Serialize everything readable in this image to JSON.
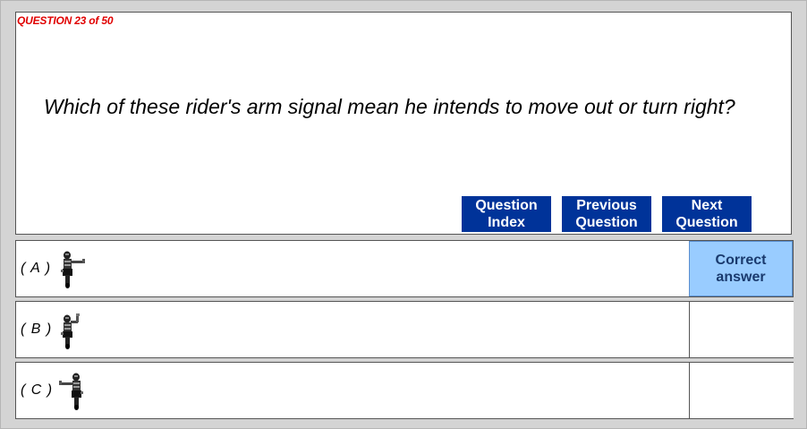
{
  "header": {
    "counter": "QUESTION 23 of 50"
  },
  "question": {
    "text": "Which of these rider's arm signal mean he intends to move out or turn right?"
  },
  "navigation": {
    "index": {
      "line1": "Question",
      "line2": "Index"
    },
    "previous": {
      "line1": "Previous",
      "line2": "Question"
    },
    "next": {
      "line1": "Next",
      "line2": "Question"
    }
  },
  "answers": [
    {
      "letter": "( A )",
      "image": "rider-arm-out-right-icon",
      "status_line1": "Correct",
      "status_line2": "answer",
      "is_correct": true
    },
    {
      "letter": "( B )",
      "image": "rider-arm-up-icon",
      "status_line1": "",
      "status_line2": "",
      "is_correct": false
    },
    {
      "letter": "( C )",
      "image": "rider-arm-out-left-icon",
      "status_line1": "",
      "status_line2": "",
      "is_correct": false
    }
  ],
  "colors": {
    "counter_red": "#e00000",
    "button_blue": "#003399",
    "correct_highlight": "#99ccff",
    "background_gray": "#d4d4d4"
  }
}
